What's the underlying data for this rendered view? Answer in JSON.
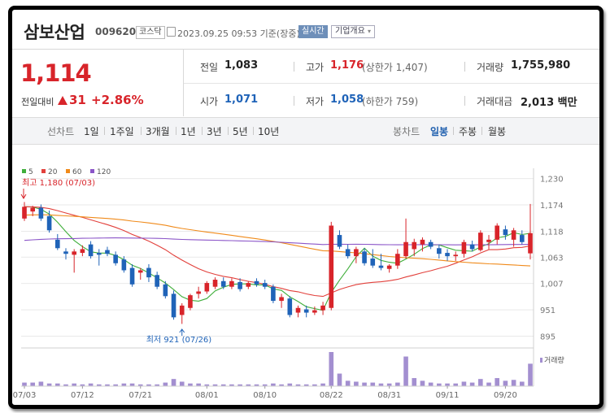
{
  "header": {
    "name": "삼보산업",
    "code": "009620",
    "market": "코스닥",
    "datetime": "2023.09.25 09:53 기준(장중)",
    "realtime": "실시간",
    "company_info": "기업개요",
    "dropdown_icon": "chevron-down-icon"
  },
  "price": {
    "current": "1,114",
    "change_label": "전일대비",
    "change": "31",
    "change_pct": "+2.86%",
    "up_color": "#d8242a",
    "down_color": "#1f63b8"
  },
  "stats": {
    "prev_close_label": "전일",
    "prev_close": "1,083",
    "high_label": "고가",
    "high": "1,176",
    "upper_limit": "(상한가 1,407)",
    "volume_label": "거래량",
    "volume": "1,755,980",
    "open_label": "시가",
    "open": "1,071",
    "low_label": "저가",
    "low": "1,058",
    "lower_limit": "(하한가 759)",
    "amount_label": "거래대금",
    "amount": "2,013 백만"
  },
  "periods": {
    "label": "선차트",
    "items": [
      "1일",
      "1주일",
      "3개월",
      "1년",
      "3년",
      "5년",
      "10년"
    ]
  },
  "candles_tabs": {
    "label": "봉차트",
    "items": [
      "일봉",
      "주봉",
      "월봉"
    ],
    "active": "일봉"
  },
  "chart_data": {
    "type": "candlestick",
    "legend": [
      {
        "name": "5",
        "color": "#3fae3a"
      },
      {
        "name": "20",
        "color": "#e2403b"
      },
      {
        "name": "60",
        "color": "#f08a1a"
      },
      {
        "name": "120",
        "color": "#8b55c8"
      }
    ],
    "y_ticks": [
      1230,
      1174,
      1118,
      1063,
      1007,
      951,
      895
    ],
    "ylim": [
      882,
      1238
    ],
    "x_ticks": [
      "07/03",
      "07/12",
      "07/21",
      "08/01",
      "08/10",
      "08/22",
      "08/31",
      "09/11",
      "09/20"
    ],
    "x_tick_index": [
      0,
      7,
      14,
      22,
      29,
      37,
      44,
      51,
      58
    ],
    "high_annotation": "최고 1,180 (07/03)",
    "low_annotation": "최저 921 (07/26)",
    "volume_label": "거래량",
    "ohlc": [
      [
        1145,
        1180,
        1140,
        1170
      ],
      [
        1160,
        1172,
        1150,
        1168
      ],
      [
        1168,
        1175,
        1140,
        1145
      ],
      [
        1150,
        1162,
        1115,
        1120
      ],
      [
        1100,
        1112,
        1078,
        1082
      ],
      [
        1075,
        1082,
        1058,
        1070
      ],
      [
        1068,
        1080,
        1030,
        1075
      ],
      [
        1072,
        1088,
        1065,
        1080
      ],
      [
        1090,
        1097,
        1060,
        1065
      ],
      [
        1072,
        1080,
        1045,
        1068
      ],
      [
        1078,
        1085,
        1065,
        1070
      ],
      [
        1068,
        1075,
        1045,
        1050
      ],
      [
        1058,
        1065,
        1030,
        1035
      ],
      [
        1040,
        1048,
        1000,
        1005
      ],
      [
        1030,
        1040,
        1015,
        1035
      ],
      [
        1040,
        1048,
        1010,
        1020
      ],
      [
        1025,
        1032,
        995,
        1000
      ],
      [
        1005,
        1012,
        975,
        980
      ],
      [
        985,
        992,
        930,
        935
      ],
      [
        940,
        965,
        921,
        960
      ],
      [
        955,
        985,
        950,
        982
      ],
      [
        985,
        1000,
        975,
        990
      ],
      [
        990,
        1012,
        985,
        1008
      ],
      [
        1000,
        1020,
        995,
        1015
      ],
      [
        1012,
        1020,
        995,
        1000
      ],
      [
        1000,
        1018,
        995,
        1012
      ],
      [
        1010,
        1018,
        990,
        995
      ],
      [
        1000,
        1012,
        995,
        1008
      ],
      [
        1012,
        1018,
        1000,
        1005
      ],
      [
        1008,
        1015,
        995,
        1000
      ],
      [
        1000,
        1005,
        965,
        970
      ],
      [
        970,
        985,
        955,
        978
      ],
      [
        975,
        980,
        935,
        940
      ],
      [
        945,
        960,
        935,
        955
      ],
      [
        952,
        960,
        935,
        945
      ],
      [
        945,
        958,
        940,
        950
      ],
      [
        950,
        968,
        940,
        960
      ],
      [
        955,
        1138,
        950,
        1130
      ],
      [
        1110,
        1120,
        1080,
        1085
      ],
      [
        1080,
        1090,
        1060,
        1065
      ],
      [
        1065,
        1085,
        1050,
        1080
      ],
      [
        1075,
        1082,
        1045,
        1050
      ],
      [
        1060,
        1080,
        1040,
        1045
      ],
      [
        1045,
        1070,
        1035,
        1040
      ],
      [
        1038,
        1048,
        1030,
        1045
      ],
      [
        1045,
        1080,
        1038,
        1070
      ],
      [
        1065,
        1145,
        1060,
        1095
      ],
      [
        1080,
        1102,
        1065,
        1095
      ],
      [
        1090,
        1105,
        1075,
        1100
      ],
      [
        1095,
        1100,
        1080,
        1085
      ],
      [
        1082,
        1090,
        1060,
        1070
      ],
      [
        1072,
        1080,
        1055,
        1065
      ],
      [
        1065,
        1075,
        1055,
        1068
      ],
      [
        1070,
        1100,
        1062,
        1095
      ],
      [
        1090,
        1098,
        1075,
        1080
      ],
      [
        1078,
        1120,
        1075,
        1115
      ],
      [
        1095,
        1110,
        1080,
        1100
      ],
      [
        1100,
        1135,
        1090,
        1130
      ],
      [
        1122,
        1130,
        1100,
        1110
      ],
      [
        1100,
        1125,
        1085,
        1120
      ],
      [
        1110,
        1120,
        1090,
        1095
      ],
      [
        1071,
        1176,
        1058,
        1114
      ]
    ],
    "volume": [
      4,
      4,
      5,
      3,
      3,
      2,
      3,
      2,
      3,
      2,
      2,
      2,
      3,
      3,
      2,
      2,
      2,
      4,
      8,
      5,
      3,
      3,
      2,
      2,
      2,
      2,
      2,
      2,
      2,
      2,
      3,
      2,
      3,
      2,
      2,
      2,
      3,
      38,
      14,
      6,
      5,
      4,
      4,
      3,
      3,
      4,
      33,
      9,
      6,
      4,
      3,
      3,
      3,
      5,
      4,
      8,
      4,
      9,
      6,
      7,
      5,
      25
    ]
  }
}
